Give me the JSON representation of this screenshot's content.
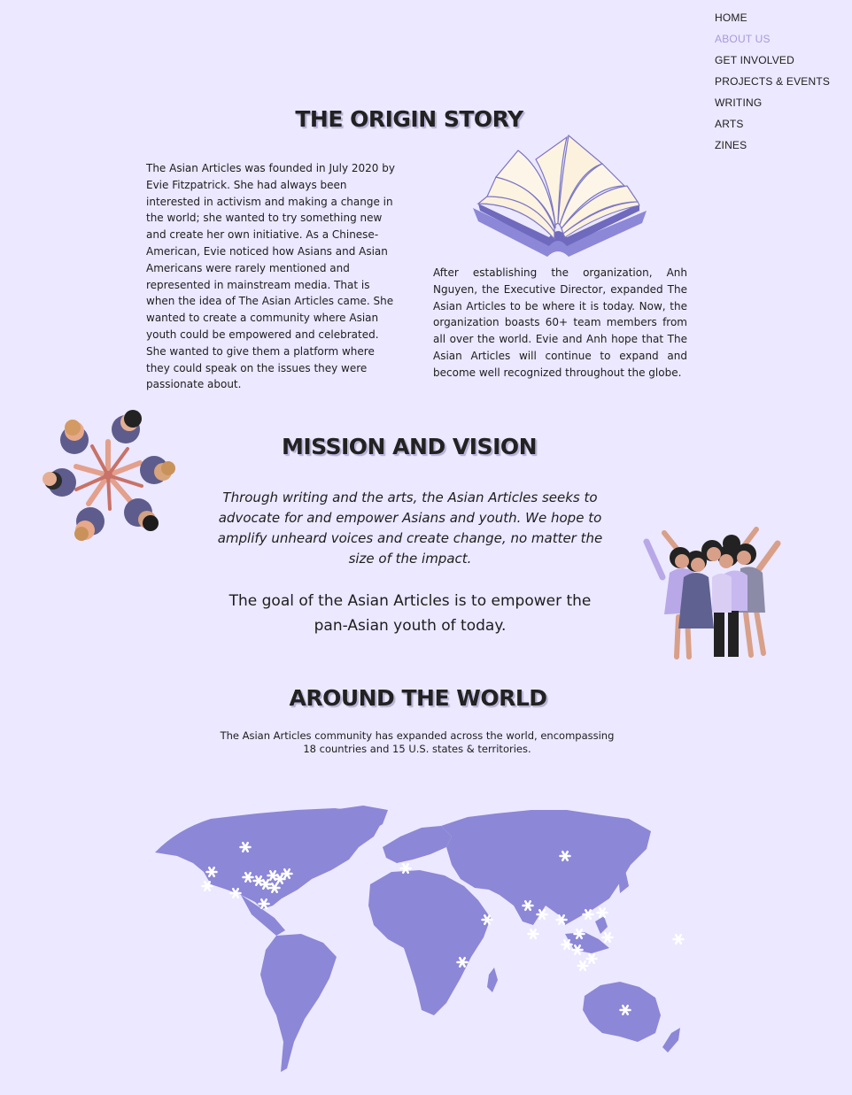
{
  "nav": {
    "items": [
      {
        "label": "HOME",
        "active": false
      },
      {
        "label": "ABOUT US",
        "active": true
      },
      {
        "label": "GET INVOLVED",
        "active": false
      },
      {
        "label": "PROJECTS & EVENTS",
        "active": false
      },
      {
        "label": "WRITING",
        "active": false
      },
      {
        "label": "ARTS",
        "active": false
      },
      {
        "label": "ZINES",
        "active": false
      }
    ]
  },
  "origin": {
    "title": "THE ORIGIN STORY",
    "paragraph1": "The Asian Articles was founded in July 2020 by Evie Fitzpatrick. She had always been interested in activism and making a change in the world; she wanted to try something new and create her own initiative.  As a Chinese-American, Evie noticed how Asians and Asian Americans were rarely mentioned and represented in mainstream media. That is when the idea of The Asian Articles came. She wanted to create a community where Asian youth could be empowered and celebrated. She wanted to give them a platform where they could speak on the issues they were passionate about.",
    "paragraph2": "After establishing the organization, Anh Nguyen, the Executive Director, expanded The Asian Articles to be where it is today. Now, the organization boasts 60+ team members from all over the world. Evie and Anh hope that The Asian Articles will continue to expand and become well recognized throughout the globe."
  },
  "mission": {
    "title": "MISSION AND VISION",
    "statement": "Through writing and the arts, the Asian Articles seeks to advocate for and empower Asians and youth. We hope to amplify unheard voices and create change, no matter the size of the impact.",
    "goal": "The goal of the Asian Articles is to empower the pan-Asian youth of today."
  },
  "world": {
    "title": "AROUND THE WORLD",
    "description": "The Asian Articles community has expanded across the world, encompassing 18 countries and 15 U.S. states & territories."
  },
  "colors": {
    "background": "#ece8ff",
    "accent": "#a99ad9",
    "map": "#8c87d6",
    "marker": "#ffffff"
  },
  "icons": [
    "open-book-icon",
    "hands-circle-icon",
    "group-celebrating-icon",
    "world-map",
    "star-marker-icon"
  ]
}
